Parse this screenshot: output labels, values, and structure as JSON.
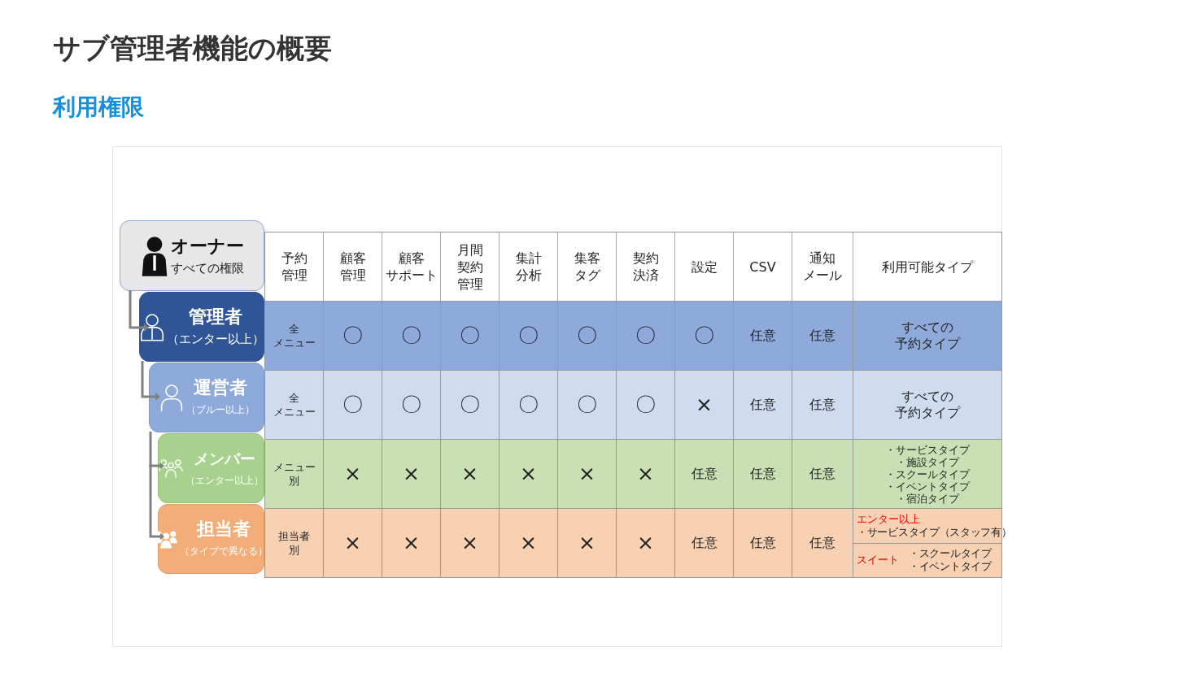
{
  "title": "サブ管理者機能の概要",
  "section": "利用権限",
  "roles": [
    {
      "kind": "owner",
      "name": "オーナー",
      "note": "すべての権限"
    },
    {
      "kind": "admin",
      "name": "管理者",
      "note": "（エンター以上）"
    },
    {
      "kind": "operator",
      "name": "運営者",
      "note": "（ブルー以上）"
    },
    {
      "kind": "member",
      "name": "メンバー",
      "note": "（エンター以上）"
    },
    {
      "kind": "staff",
      "name": "担当者",
      "note": "（タイプで異なる）"
    }
  ],
  "columns": [
    [
      "予約",
      "管理"
    ],
    [
      "顧客",
      "管理"
    ],
    [
      "顧客",
      "サポート"
    ],
    [
      "月間",
      "契約",
      "管理"
    ],
    [
      "集計",
      "分析"
    ],
    [
      "集客",
      "タグ"
    ],
    [
      "契約",
      "決済"
    ],
    [
      "設定"
    ],
    [
      "CSV"
    ],
    [
      "通知",
      "メール"
    ],
    [
      "利用可能タイプ"
    ]
  ],
  "rows": [
    {
      "kind": "admin",
      "menu": [
        "全",
        "メニュー"
      ],
      "cells": [
        "〇",
        "〇",
        "〇",
        "〇",
        "〇",
        "〇",
        "〇",
        "任意",
        "任意"
      ],
      "types": [
        {
          "kind": "plain",
          "lines": [
            "すべての",
            "予約タイプ"
          ]
        }
      ]
    },
    {
      "kind": "operator",
      "menu": [
        "全",
        "メニュー"
      ],
      "cells": [
        "〇",
        "〇",
        "〇",
        "〇",
        "〇",
        "〇",
        "×",
        "任意",
        "任意"
      ],
      "types": [
        {
          "kind": "plain",
          "lines": [
            "すべての",
            "予約タイプ"
          ]
        }
      ]
    },
    {
      "kind": "member",
      "menu": [
        "メニュー",
        "別"
      ],
      "cells": [
        "×",
        "×",
        "×",
        "×",
        "×",
        "×",
        "任意",
        "任意",
        "任意"
      ],
      "types": [
        {
          "kind": "list",
          "lines": [
            "・サービスタイプ",
            "・施設タイプ",
            "・スクールタイプ",
            "・イベントタイプ",
            "・宿泊タイプ"
          ]
        }
      ]
    },
    {
      "kind": "staff",
      "menu": [
        "担当者",
        "別"
      ],
      "cells": [
        "×",
        "×",
        "×",
        "×",
        "×",
        "×",
        "任意",
        "任意",
        "任意"
      ],
      "types": [
        {
          "kind": "stacked",
          "plan": "エンター以上",
          "lines": [
            "・サービスタイプ（スタッフ有）"
          ]
        },
        {
          "kind": "side",
          "plan": "スイート",
          "lines": [
            "・スクールタイプ",
            "・イベントタイプ"
          ]
        }
      ]
    }
  ]
}
